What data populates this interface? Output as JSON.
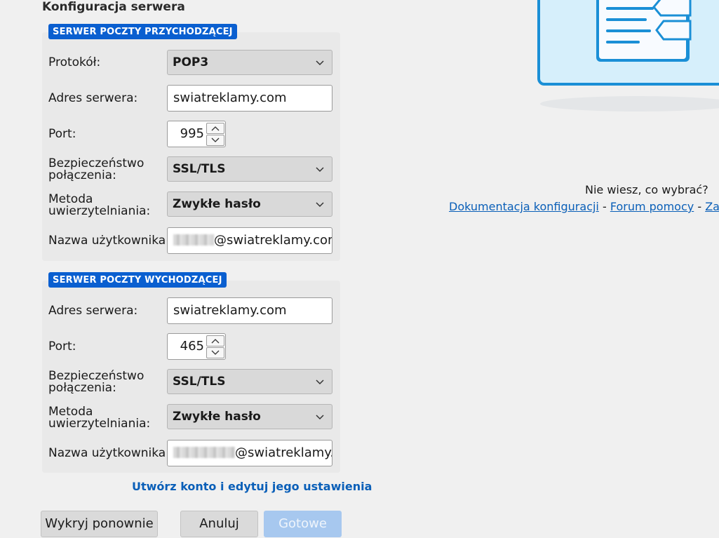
{
  "page": {
    "title": "Konfiguracja serwera"
  },
  "incoming": {
    "legend": "SERWER POCZTY PRZYCHODZĄCEJ",
    "protocol_label": "Protokół:",
    "protocol_value": "POP3",
    "server_label": "Adres serwera:",
    "server_value": "swiatreklamy.com",
    "port_label": "Port:",
    "port_value": "995",
    "security_label_1": "Bezpieczeństwo",
    "security_label_2": "połączenia:",
    "security_value": "SSL/TLS",
    "auth_label_1": "Metoda",
    "auth_label_2": "uwierzytelniania:",
    "auth_value": "Zwykłe hasło",
    "username_label": "Nazwa użytkownika:",
    "username_domain": "@swiatreklamy.com"
  },
  "outgoing": {
    "legend": "SERWER POCZTY WYCHODZĄCEJ",
    "server_label": "Adres serwera:",
    "server_value": "swiatreklamy.com",
    "port_label": "Port:",
    "port_value": "465",
    "security_label_1": "Bezpieczeństwo",
    "security_label_2": "połączenia:",
    "security_value": "SSL/TLS",
    "auth_label_1": "Metoda",
    "auth_label_2": "uwierzytelniania:",
    "auth_value": "Zwykłe hasło",
    "username_label": "Nazwa użytkownika:",
    "username_domain": "@swiatreklamy.c"
  },
  "actions": {
    "create_link": "Utwórz konto i edytuj jego ustawienia",
    "redetect": "Wykryj ponownie",
    "cancel": "Anuluj",
    "done": "Gotowe"
  },
  "help": {
    "question": "Nie wiesz, co wybrać?",
    "link_docs": "Dokumentacja konfiguracji",
    "sep": " - ",
    "link_forum": "Forum pomocy",
    "link_privacy": "Zasady"
  },
  "colors": {
    "accent": "#0a5fd0",
    "link": "#0a5fb8",
    "disabled_primary": "#a7c8ef"
  }
}
